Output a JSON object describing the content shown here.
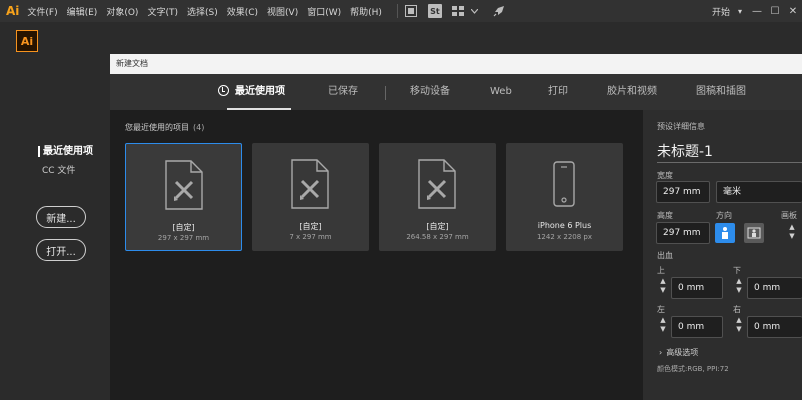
{
  "menubar": {
    "app_mark": "Ai",
    "items": [
      "文件(F)",
      "编辑(E)",
      "对象(O)",
      "文字(T)",
      "选择(S)",
      "效果(C)",
      "视图(V)",
      "窗口(W)",
      "帮助(H)"
    ],
    "stock_label": "St",
    "workspace_label": "开始",
    "workspace_arrow": "▾",
    "minimize": "—",
    "maximize": "☐",
    "close": "✕"
  },
  "app": {
    "logo_text": "Ai"
  },
  "left_panel": {
    "recent_label": "最近使用项",
    "cc_files_label": "CC 文件",
    "new_button": "新建...",
    "open_button": "打开..."
  },
  "dialog": {
    "title": "新建文档",
    "tabs": [
      "最近使用项",
      "已保存",
      "移动设备",
      "Web",
      "打印",
      "胶片和视频",
      "图稿和插图"
    ],
    "recent_header": "您最近使用的项目",
    "recent_count": "(4)",
    "recent_items": [
      {
        "name": "[自定]",
        "size": "297 x 297 mm",
        "icon": "document-pen-icon",
        "selected": true
      },
      {
        "name": "[自定]",
        "size": "7 x 297 mm",
        "icon": "document-pen-icon",
        "selected": false
      },
      {
        "name": "[自定]",
        "size": "264.58 x 297 mm",
        "icon": "document-pen-icon",
        "selected": false
      },
      {
        "name": "iPhone 6 Plus",
        "size": "1242 x 2208 px",
        "icon": "phone-icon",
        "selected": false
      }
    ]
  },
  "details": {
    "section_title": "预设详细信息",
    "document_name": "未标题-1",
    "width_label": "宽度",
    "width_value": "297 mm",
    "unit_value": "毫米",
    "height_label": "高度",
    "height_value": "297 mm",
    "orientation_label": "方向",
    "artboards_label": "画板",
    "bleed_label": "出血",
    "top_label": "上",
    "top_value": "0 mm",
    "bottom_label": "下",
    "bottom_value": "0 mm",
    "left_label": "左",
    "left_value": "0 mm",
    "right_label": "右",
    "right_value": "0 mm",
    "advanced_label": "高级选项",
    "color_mode": "颜色模式:RGB, PPI:72"
  },
  "colors": {
    "accent": "#2d8ceb",
    "ai_orange": "#f7931e"
  }
}
